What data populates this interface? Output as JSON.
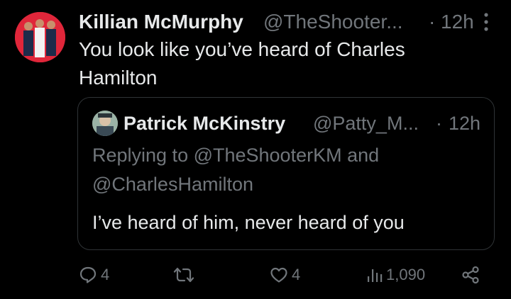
{
  "tweet": {
    "author_name": "Killian McMurphy",
    "author_handle": "@TheShooter...",
    "separator": "·",
    "time": "12h",
    "text": "You look like you’ve heard of Charles Hamilton"
  },
  "quoted": {
    "author_name": "Patrick McKinstry",
    "author_handle": "@Patty_M...",
    "separator": "·",
    "time": "12h",
    "replying_to": "Replying to @TheShooterKM and @CharlesHamilton",
    "text": "I’ve heard of him, never heard of you"
  },
  "actions": {
    "reply_count": "4",
    "like_count": "4",
    "views_count": "1,090"
  },
  "colors": {
    "background": "#000000",
    "text_primary": "#e7e9ea",
    "text_secondary": "#71767b",
    "border": "#2f3336",
    "avatar_bg": "#e0263a"
  },
  "icons": [
    "avatar",
    "more-icon",
    "reply-icon",
    "retweet-icon",
    "like-icon",
    "views-icon",
    "share-icon"
  ]
}
